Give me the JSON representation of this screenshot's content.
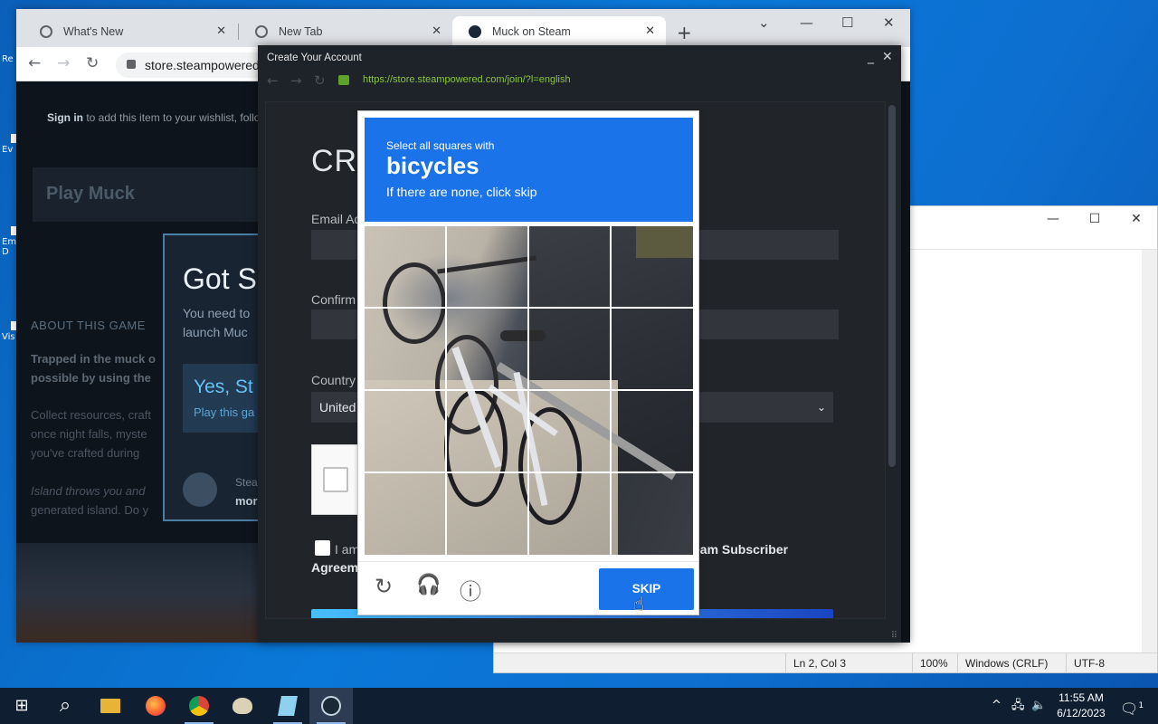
{
  "chrome": {
    "tabs": [
      {
        "title": "What's New",
        "close": "✕"
      },
      {
        "title": "New Tab",
        "close": "✕"
      },
      {
        "title": "Muck on Steam",
        "close": "✕"
      }
    ],
    "new_tab": "+",
    "controls": {
      "dropdown": "⌄",
      "minimize": "—",
      "maximize": "☐",
      "close": "✕"
    },
    "nav": {
      "back": "←",
      "forward": "→",
      "reload": "↻"
    },
    "url": "store.steampowered.com"
  },
  "steam_page": {
    "wishlist_bold": "Sign in",
    "wishlist_text": " to add this item to your wishlist, follo",
    "play_title": "Play Muck",
    "about_heading": "ABOUT THIS GAME",
    "desc": [
      "Trapped in the muck o",
      "possible by using the",
      "Collect resources, craft",
      "once night falls, myste",
      "you've crafted during",
      "Island throws you and",
      "generated island. Do y"
    ],
    "got_steam": {
      "title": "Got S",
      "need_1": "You need to",
      "need_2": "launch Muc",
      "yes_title": "Yes, St",
      "yes_sub": "Play this ga",
      "steam_line": "Stea",
      "more_line": "mor"
    }
  },
  "popup": {
    "title": "Create Your Account",
    "minimize": "_",
    "close": "✕",
    "nav": {
      "back": "←",
      "forward": "→",
      "reload": "↻"
    },
    "url": "https://store.steampowered.com/join/?l=english",
    "heading": "CRE",
    "email_label": "Email Ad",
    "confirm_label": "Confirm",
    "country_label": "Country",
    "country_value": "United",
    "country_chevron": "⌄",
    "agree_text": "I am",
    "agreement_word": "Agreem",
    "ssa_text": "eam Subscriber"
  },
  "captcha": {
    "instruction": "Select all squares with",
    "target": "bicycles",
    "hint": "If there are none, click skip",
    "icons": {
      "reload": "reload-icon",
      "audio": "headphones-icon",
      "info": "info-icon"
    },
    "reload_glyph": "↻",
    "audio_glyph": "🎧",
    "info_glyph": "ⓘ",
    "skip_label": "SKIP"
  },
  "notepad": {
    "controls": {
      "minimize": "—",
      "maximize": "☐",
      "close": "✕"
    },
    "status": {
      "position": "Ln 2, Col 3",
      "zoom": "100%",
      "line_ending": "Windows (CRLF)",
      "encoding": "UTF-8"
    }
  },
  "desktop": {
    "icon_labels": [
      "Re",
      "Ev",
      "Em",
      "D",
      "Vis"
    ]
  },
  "taskbar": {
    "start": "⊞",
    "search": "⌕",
    "apps": [
      "file-explorer-icon",
      "firefox-icon",
      "chrome-icon",
      "paint-icon",
      "notepad-icon",
      "steam-icon"
    ],
    "tray": {
      "chevron": "^",
      "network": "🖧",
      "volume": "🔈"
    },
    "time": "11:55 AM",
    "date": "6/12/2023",
    "notifications_count": "1"
  }
}
